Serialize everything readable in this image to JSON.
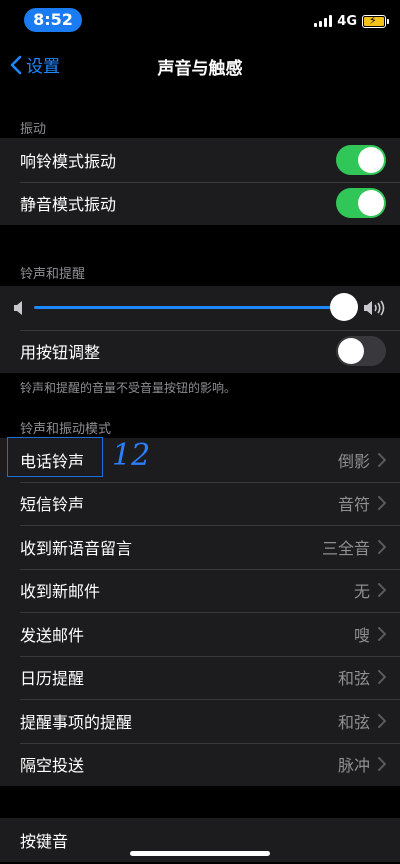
{
  "status": {
    "time": "8:52",
    "network": "4G"
  },
  "nav": {
    "back_label": "设置",
    "title": "声音与触感"
  },
  "vibration": {
    "header": "振动",
    "items": [
      {
        "label": "响铃模式振动",
        "on": true
      },
      {
        "label": "静音模式振动",
        "on": true
      }
    ]
  },
  "ringer": {
    "header": "铃声和提醒",
    "volume_level": 1.0,
    "button_adjust_label": "用按钮调整",
    "button_adjust_on": false,
    "footnote": "铃声和提醒的音量不受音量按钮的影响。"
  },
  "patterns": {
    "header": "铃声和振动模式",
    "items": [
      {
        "label": "电话铃声",
        "value": "倒影"
      },
      {
        "label": "短信铃声",
        "value": "音符"
      },
      {
        "label": "收到新语音留言",
        "value": "三全音"
      },
      {
        "label": "收到新邮件",
        "value": "无"
      },
      {
        "label": "发送邮件",
        "value": "嗖"
      },
      {
        "label": "日历提醒",
        "value": "和弦"
      },
      {
        "label": "提醒事项的提醒",
        "value": "和弦"
      },
      {
        "label": "隔空投送",
        "value": "脉冲"
      }
    ]
  },
  "keyboard": {
    "label": "按键音"
  },
  "annotation": {
    "text": "12"
  },
  "colors": {
    "accent": "#1e88ff",
    "toggle_on": "#31c758",
    "cell_bg": "#1c1c1e"
  }
}
